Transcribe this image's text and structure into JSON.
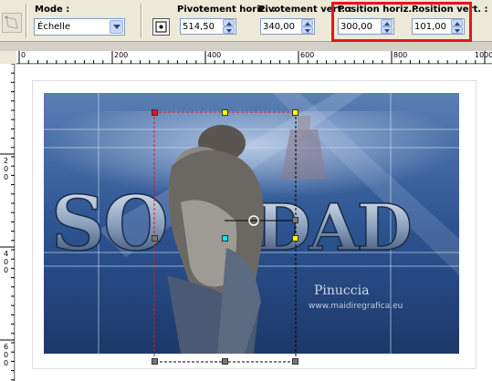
{
  "toolbar": {
    "mode": {
      "label": "Mode :",
      "value": "Échelle"
    },
    "pivot_h": {
      "label": "Pivotement horiz. :",
      "value": "514,50"
    },
    "pivot_v": {
      "label": "Pivotement vert. :",
      "value": "340,00"
    },
    "pos_h": {
      "label": "Position horiz. :",
      "value": "300,00"
    },
    "pos_v": {
      "label": "Position vert. :",
      "value": "101,00"
    }
  },
  "ruler": {
    "top_ticks": [
      "0",
      "200",
      "400",
      "600",
      "800",
      "1000"
    ],
    "left_ticks": [
      "200",
      "400",
      "600"
    ]
  },
  "canvas": {
    "title_text": "SOLEDAD",
    "signature": "Pinuccia",
    "signature_url": "www.maidiregrafica.eu"
  },
  "colors": {
    "highlight": "#e8141c",
    "bg_blue": "#2d4f82"
  }
}
